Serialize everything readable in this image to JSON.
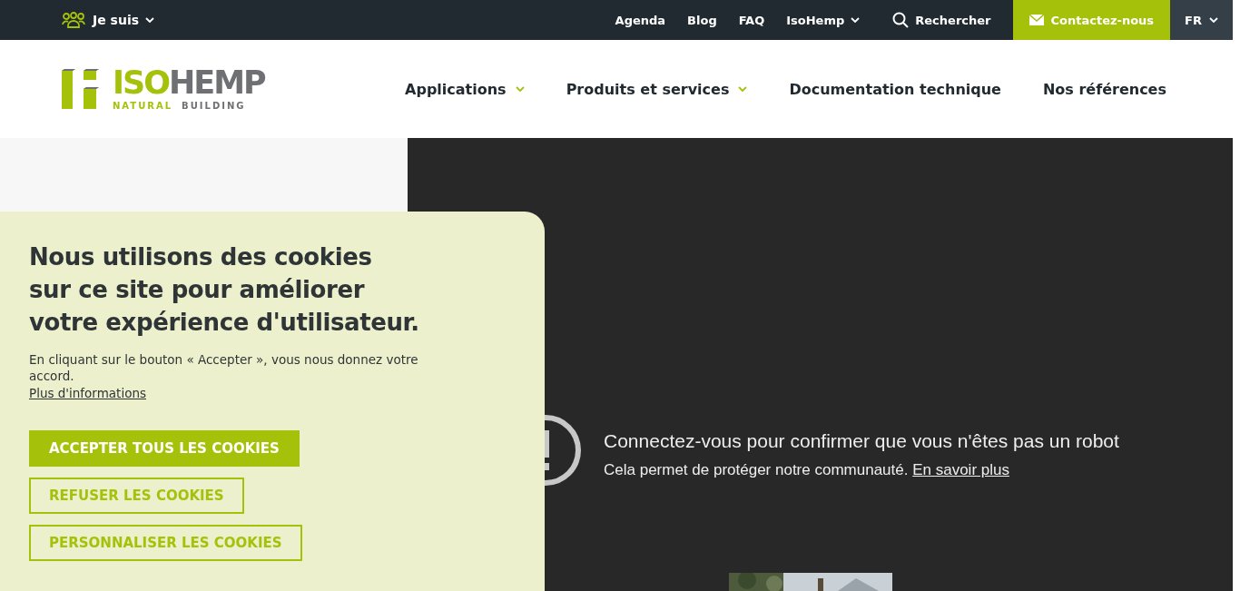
{
  "top_bar": {
    "audience_menu": {
      "label": "Je suis",
      "has_dropdown": true
    },
    "links": [
      {
        "label": "Agenda",
        "has_dropdown": false
      },
      {
        "label": "Blog",
        "has_dropdown": false
      },
      {
        "label": "FAQ",
        "has_dropdown": false
      },
      {
        "label": "IsoHemp",
        "has_dropdown": true
      }
    ],
    "search": {
      "label": "Rechercher"
    },
    "contact_button": {
      "label": "Contactez-nous"
    },
    "language": {
      "label": "FR",
      "has_dropdown": true
    }
  },
  "header": {
    "logo": {
      "primary": "ISO",
      "secondary": "HEMP",
      "tagline_primary": "NATURAL",
      "tagline_secondary": "BUILDING"
    },
    "nav": [
      {
        "label": "Applications",
        "has_dropdown": true
      },
      {
        "label": "Produits et services",
        "has_dropdown": true
      },
      {
        "label": "Documentation technique",
        "has_dropdown": false
      },
      {
        "label": "Nos références",
        "has_dropdown": false
      }
    ]
  },
  "video": {
    "title": "Connectez-vous pour confirmer que vous n'êtes pas un robot",
    "message": "Cela permet de protéger notre communauté.",
    "link": "En savoir plus"
  },
  "cookie_banner": {
    "title": "Nous utilisons des cookies\nsur ce site pour améliorer\nvotre expérience d'utilisateur.",
    "text": "En cliquant sur le bouton « Accepter », vous nous donnez votre accord.",
    "more_link": "Plus d'informations",
    "buttons": [
      {
        "label": "ACCEPTER TOUS LES COOKIES",
        "kind": "primary"
      },
      {
        "label": "REFUSER LES COOKIES",
        "kind": "outline"
      },
      {
        "label": "PERSONNALISER LES COOKIES",
        "kind": "outline"
      }
    ]
  }
}
